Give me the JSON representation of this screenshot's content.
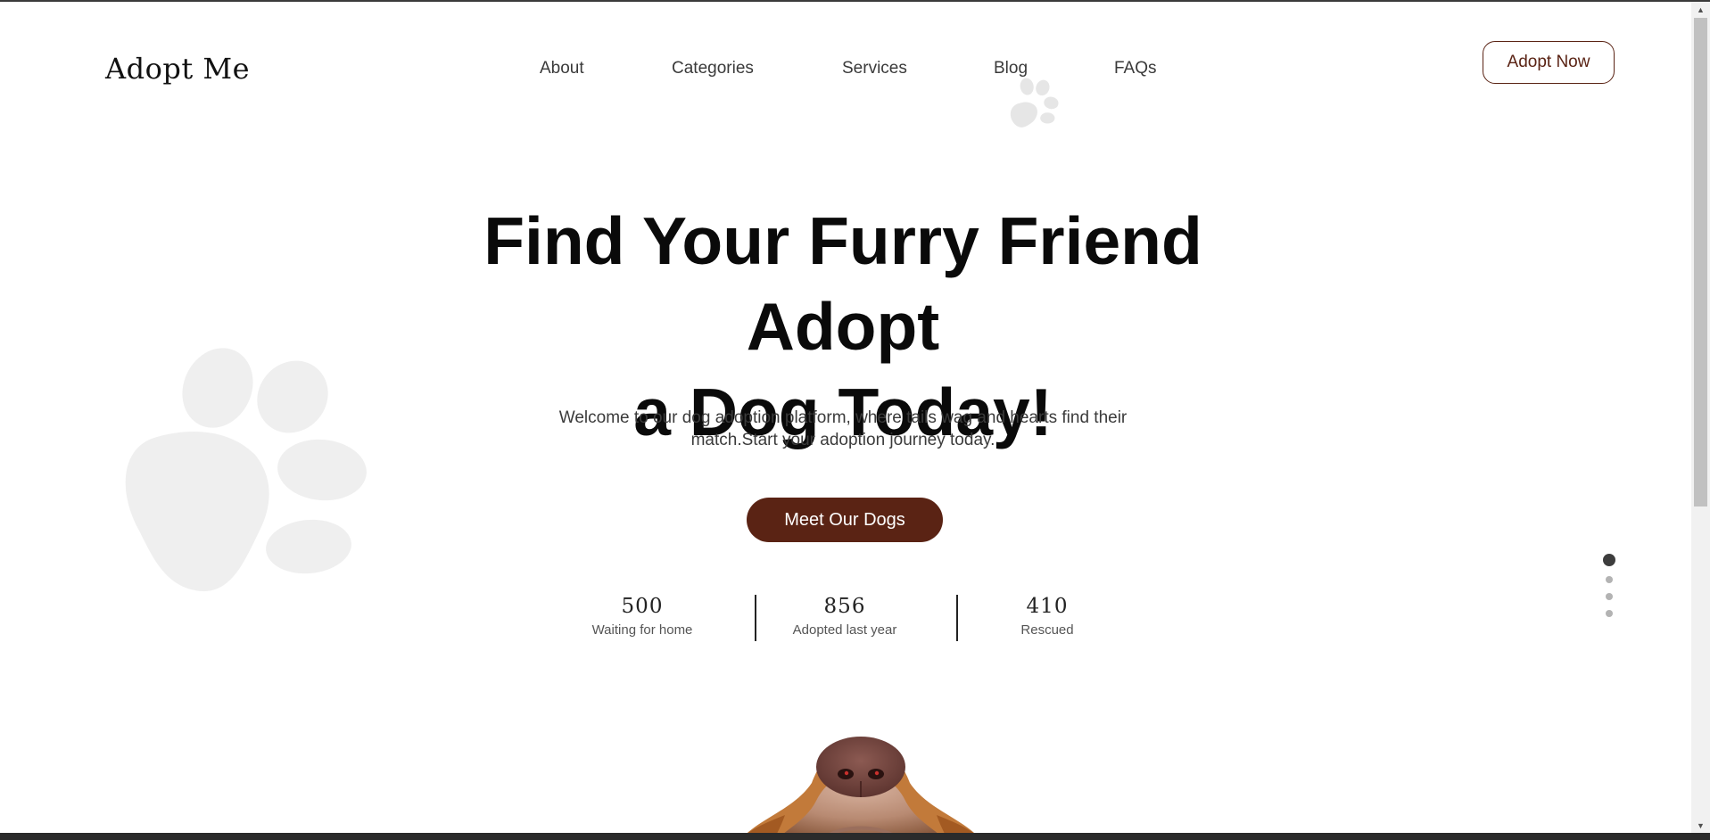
{
  "brand": {
    "logo": "Adopt Me",
    "accent": "#5a2314"
  },
  "nav": {
    "items": [
      {
        "label": "About"
      },
      {
        "label": "Categories"
      },
      {
        "label": "Services"
      },
      {
        "label": "Blog"
      },
      {
        "label": "FAQs"
      }
    ],
    "cta_label": "Adopt Now"
  },
  "hero": {
    "title_line1": "Find Your Furry Friend Adopt",
    "title_line2": "a Dog Today!",
    "subtitle_line1": "Welcome to our dog adoption platform, where tails wag and hearts find their",
    "subtitle_line2": "match.Start your adoption journey today.",
    "cta_label": "Meet Our Dogs"
  },
  "stats": [
    {
      "value": "500",
      "label": "Waiting for home"
    },
    {
      "value": "856",
      "label": "Adopted last year"
    },
    {
      "value": "410",
      "label": "Rescued"
    }
  ],
  "pagination": {
    "count": 4,
    "active_index": 0
  },
  "icons": {
    "decor": "paw-print-icon",
    "hero_image": "dog-snout-image"
  }
}
